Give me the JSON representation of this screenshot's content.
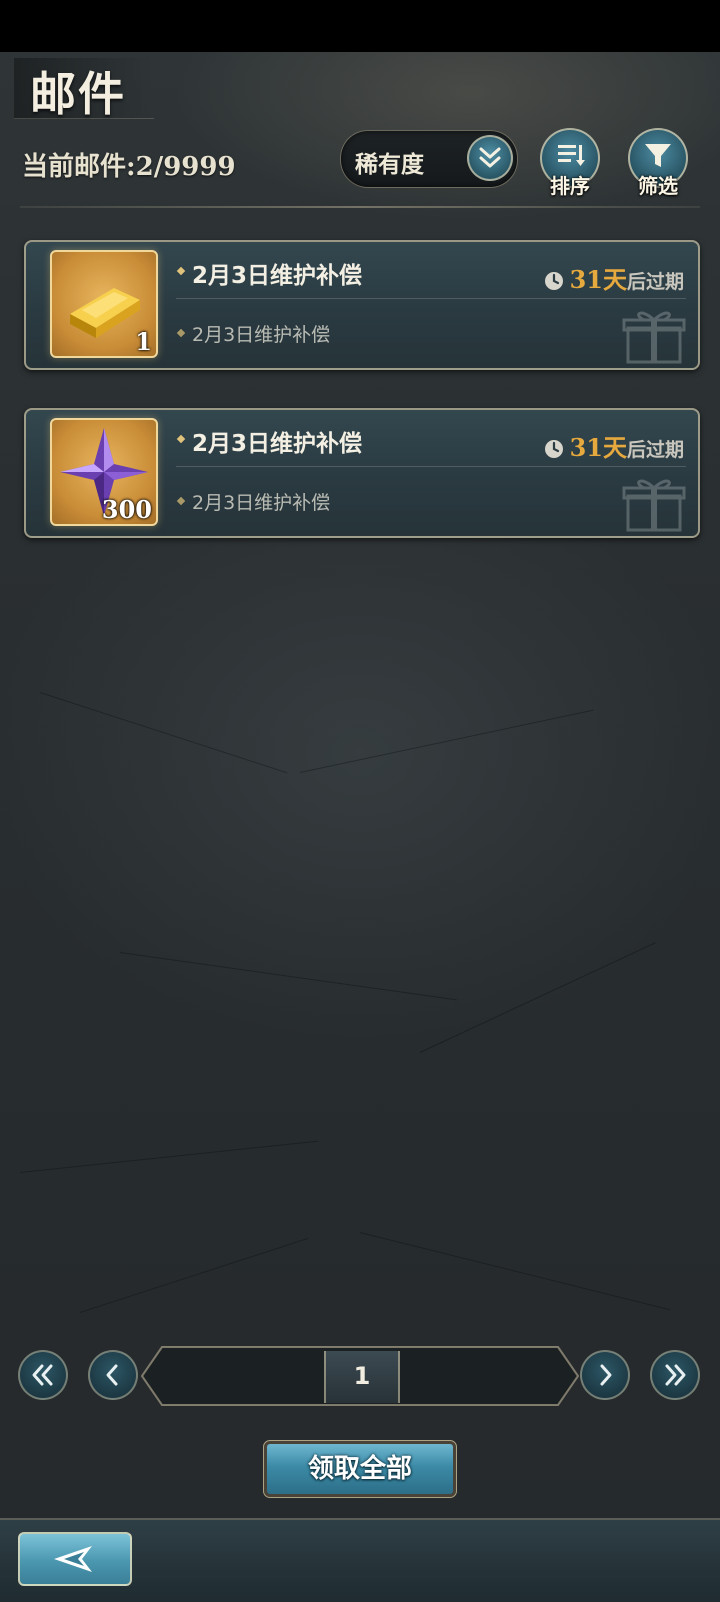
{
  "header": {
    "title": "邮件",
    "mail_count_label": "当前邮件:",
    "mail_count_value": "2/9999"
  },
  "filters": {
    "rarity_label": "稀有度",
    "sort_label": "排序",
    "filter_label": "筛选"
  },
  "mails": [
    {
      "title": "2月3日维护补偿",
      "subtitle": "2月3日维护补偿",
      "item_icon": "gold-bar-icon",
      "item_quantity": "1",
      "expire_days": "31天",
      "expire_suffix": "后过期"
    },
    {
      "title": "2月3日维护补偿",
      "subtitle": "2月3日维护补偿",
      "item_icon": "purple-crystal-icon",
      "item_quantity": "300",
      "expire_days": "31天",
      "expire_suffix": "后过期"
    }
  ],
  "pagination": {
    "current_page": "1"
  },
  "actions": {
    "claim_all_label": "领取全部"
  },
  "colors": {
    "accent_gold": "#e6a93d",
    "button_blue": "#3c8aa6",
    "card_border": "#cdc3a5"
  }
}
